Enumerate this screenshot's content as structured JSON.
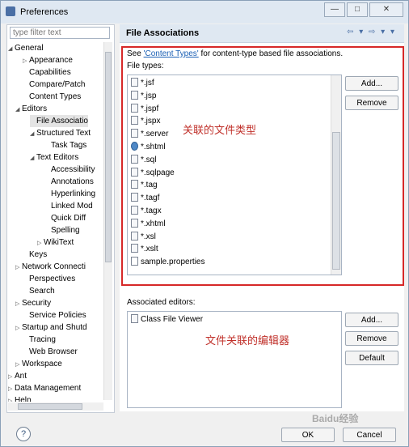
{
  "window": {
    "title": "Preferences",
    "controls": [
      "—",
      "□",
      "✕"
    ]
  },
  "filter": {
    "placeholder": "type filter text"
  },
  "tree": [
    {
      "label": "General",
      "indent": 0,
      "toggle": "◢"
    },
    {
      "label": "Appearance",
      "indent": 2,
      "toggle": "▷"
    },
    {
      "label": "Capabilities",
      "indent": 2,
      "toggle": ""
    },
    {
      "label": "Compare/Patch",
      "indent": 2,
      "toggle": ""
    },
    {
      "label": "Content Types",
      "indent": 2,
      "toggle": ""
    },
    {
      "label": "Editors",
      "indent": 1,
      "toggle": "◢"
    },
    {
      "label": "File Associatio",
      "indent": 3,
      "toggle": "",
      "selected": true
    },
    {
      "label": "Structured Text",
      "indent": 3,
      "toggle": "◢"
    },
    {
      "label": "Task Tags",
      "indent": 5,
      "toggle": ""
    },
    {
      "label": "Text Editors",
      "indent": 3,
      "toggle": "◢"
    },
    {
      "label": "Accessibility",
      "indent": 5,
      "toggle": ""
    },
    {
      "label": "Annotations",
      "indent": 5,
      "toggle": ""
    },
    {
      "label": "Hyperlinking",
      "indent": 5,
      "toggle": ""
    },
    {
      "label": "Linked Mod",
      "indent": 5,
      "toggle": ""
    },
    {
      "label": "Quick Diff",
      "indent": 5,
      "toggle": ""
    },
    {
      "label": "Spelling",
      "indent": 5,
      "toggle": ""
    },
    {
      "label": "WikiText",
      "indent": 4,
      "toggle": "▷"
    },
    {
      "label": "Keys",
      "indent": 2,
      "toggle": ""
    },
    {
      "label": "Network Connecti",
      "indent": 1,
      "toggle": "▷"
    },
    {
      "label": "Perspectives",
      "indent": 2,
      "toggle": ""
    },
    {
      "label": "Search",
      "indent": 2,
      "toggle": ""
    },
    {
      "label": "Security",
      "indent": 1,
      "toggle": "▷"
    },
    {
      "label": "Service Policies",
      "indent": 2,
      "toggle": ""
    },
    {
      "label": "Startup and Shutd",
      "indent": 1,
      "toggle": "▷"
    },
    {
      "label": "Tracing",
      "indent": 2,
      "toggle": ""
    },
    {
      "label": "Web Browser",
      "indent": 2,
      "toggle": ""
    },
    {
      "label": "Workspace",
      "indent": 1,
      "toggle": "▷"
    },
    {
      "label": "Ant",
      "indent": 0,
      "toggle": "▷"
    },
    {
      "label": "Data Management",
      "indent": 0,
      "toggle": "▷"
    },
    {
      "label": "Help",
      "indent": 0,
      "toggle": "▷"
    }
  ],
  "panel": {
    "title": "File Associations",
    "nav_icons": "⇦ ▾ ⇨ ▾ ▾",
    "see_prefix": "See ",
    "see_link": "'Content Types'",
    "see_suffix": " for content-type based file associations.",
    "file_types_label": "File types:",
    "file_types": [
      {
        "name": "*.jsf",
        "icon": "file"
      },
      {
        "name": "*.jsp",
        "icon": "file"
      },
      {
        "name": "*.jspf",
        "icon": "file"
      },
      {
        "name": "*.jspx",
        "icon": "file"
      },
      {
        "name": "*.server",
        "icon": "file"
      },
      {
        "name": "*.shtml",
        "icon": "globe"
      },
      {
        "name": "*.sql",
        "icon": "file"
      },
      {
        "name": "*.sqlpage",
        "icon": "file"
      },
      {
        "name": "*.tag",
        "icon": "file"
      },
      {
        "name": "*.tagf",
        "icon": "file"
      },
      {
        "name": "*.tagx",
        "icon": "file"
      },
      {
        "name": "*.xhtml",
        "icon": "file"
      },
      {
        "name": "*.xsl",
        "icon": "file"
      },
      {
        "name": "*.xslt",
        "icon": "file"
      },
      {
        "name": "sample.properties",
        "icon": "doc"
      }
    ],
    "file_buttons": [
      "Add...",
      "Remove"
    ],
    "annotation_top": "关联的文件类型",
    "assoc_label": "Associated editors:",
    "assoc_editors": [
      "Class File Viewer"
    ],
    "assoc_buttons": [
      "Add...",
      "Remove",
      "Default"
    ],
    "annotation_bottom": "文件关联的编辑器"
  },
  "footer": {
    "help": "?",
    "ok": "OK",
    "cancel": "Cancel",
    "watermark": "Baidu经验"
  },
  "colors": {
    "accent": "#d62828",
    "link": "#1a5fb4",
    "header": "#dfe8f2"
  }
}
